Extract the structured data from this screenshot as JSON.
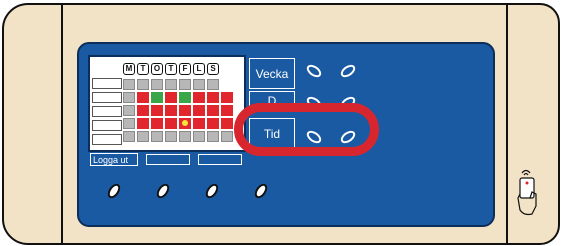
{
  "device": {
    "days": [
      "M",
      "T",
      "O",
      "T",
      "F",
      "L",
      "S"
    ],
    "grid_rows": [
      [
        "gray",
        "gray",
        "gray",
        "gray",
        "gray",
        "gray",
        "gray",
        "empty"
      ],
      [
        "gray",
        "red",
        "green",
        "red",
        "green",
        "red",
        "red",
        "red"
      ],
      [
        "gray",
        "red",
        "red",
        "red",
        "red",
        "red",
        "red",
        "red"
      ],
      [
        "gray",
        "red",
        "red",
        "red",
        "yellow",
        "red",
        "red",
        "red"
      ],
      [
        "gray",
        "gray",
        "gray",
        "gray",
        "gray",
        "gray",
        "gray",
        "gray"
      ]
    ],
    "buttons": {
      "week": "Vecka",
      "day_partial": "D",
      "time": "Tid",
      "logout": "Logga ut"
    }
  },
  "colors": {
    "panel_blue": "#1a5aa2",
    "housing": "#f3e3c6",
    "highlight": "#d8262f",
    "cell_red": "#e1262e",
    "cell_green": "#3aa64a",
    "cell_gray": "#b7b7b7",
    "marker_yellow": "#f7e33a"
  },
  "icons": {
    "reader": "nfc-card-hand-icon"
  }
}
